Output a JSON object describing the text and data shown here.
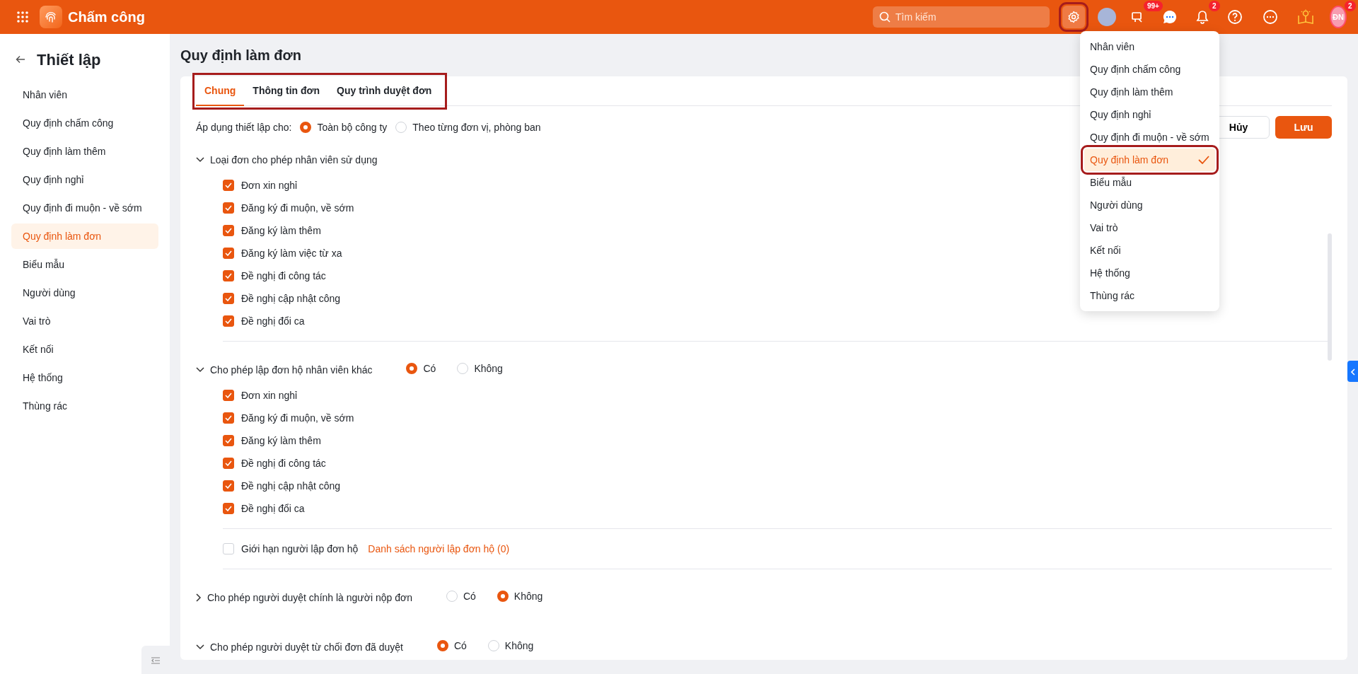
{
  "topbar": {
    "app_title": "Chấm công",
    "search": {
      "placeholder": "Tìm kiếm"
    },
    "settings_highlighted": true,
    "tasks_badge": "99+",
    "notifications_badge": "2",
    "user_initials": "ĐN",
    "user_badge": "2"
  },
  "sidebar": {
    "title": "Thiết lập",
    "items": [
      {
        "label": "Nhân viên",
        "selected": false
      },
      {
        "label": "Quy định chấm công",
        "selected": false
      },
      {
        "label": "Quy định làm thêm",
        "selected": false
      },
      {
        "label": "Quy định nghỉ",
        "selected": false
      },
      {
        "label": "Quy định đi muộn - về sớm",
        "selected": false
      },
      {
        "label": "Quy định làm đơn",
        "selected": true
      },
      {
        "label": "Biểu mẫu",
        "selected": false
      },
      {
        "label": "Người dùng",
        "selected": false
      },
      {
        "label": "Vai trò",
        "selected": false
      },
      {
        "label": "Kết nối",
        "selected": false
      },
      {
        "label": "Hệ thống",
        "selected": false
      },
      {
        "label": "Thùng rác",
        "selected": false
      }
    ]
  },
  "page_title": "Quy định làm đơn",
  "tabs_highlighted": true,
  "tabs": [
    {
      "label": "Chung",
      "selected": true
    },
    {
      "label": "Thông tin đơn",
      "selected": false
    },
    {
      "label": "Quy trình duyệt đơn",
      "selected": false
    }
  ],
  "apply_to": {
    "label": "Áp dụng thiết lập cho:",
    "options": [
      {
        "label": "Toàn bộ công ty",
        "selected": true
      },
      {
        "label": "Theo từng đơn vị, phòng ban",
        "selected": false
      }
    ]
  },
  "buttons": [
    {
      "label": "Hủy",
      "kind": "secondary"
    },
    {
      "label": "Lưu",
      "kind": "primary"
    }
  ],
  "sections": [
    {
      "title": "Loại đơn cho phép nhân viên sử dụng",
      "expanded": true,
      "items": [
        {
          "label": "Đơn xin nghỉ",
          "checked": true
        },
        {
          "label": "Đăng ký đi muộn, về sớm",
          "checked": true
        },
        {
          "label": "Đăng ký làm thêm",
          "checked": true
        },
        {
          "label": "Đăng ký làm việc từ xa",
          "checked": true
        },
        {
          "label": "Đề nghị đi công tác",
          "checked": true
        },
        {
          "label": "Đề nghị cập nhật công",
          "checked": true
        },
        {
          "label": "Đề nghị đổi ca",
          "checked": true
        }
      ]
    },
    {
      "title": "Cho phép lập đơn hộ nhân viên khác",
      "expanded": true,
      "options": [
        {
          "label": "Có",
          "selected": true
        },
        {
          "label": "Không",
          "selected": false
        }
      ],
      "items": [
        {
          "label": "Đơn xin nghỉ",
          "checked": true
        },
        {
          "label": "Đăng ký đi muộn, về sớm",
          "checked": true
        },
        {
          "label": "Đăng ký làm thêm",
          "checked": true
        },
        {
          "label": "Đề nghị đi công tác",
          "checked": true
        },
        {
          "label": "Đề nghị cập nhật công",
          "checked": true
        },
        {
          "label": "Đề nghị đổi ca",
          "checked": true
        }
      ],
      "limit": {
        "label": "Giới hạn người lập đơn hộ",
        "checked": false,
        "link": "Danh sách người lập đơn hộ (0)"
      }
    },
    {
      "title": "Cho phép người duyệt chính là người nộp đơn",
      "expanded": false,
      "options": [
        {
          "label": "Có",
          "selected": false
        },
        {
          "label": "Không",
          "selected": true
        }
      ]
    },
    {
      "title": "Cho phép người duyệt từ chối đơn đã duyệt",
      "expanded": true,
      "options": [
        {
          "label": "Có",
          "selected": true
        },
        {
          "label": "Không",
          "selected": false
        }
      ]
    }
  ],
  "settings_menu": {
    "items": [
      {
        "label": "Nhân viên",
        "selected": false,
        "highlighted": false
      },
      {
        "label": "Quy định chấm công",
        "selected": false,
        "highlighted": false
      },
      {
        "label": "Quy định làm thêm",
        "selected": false,
        "highlighted": false
      },
      {
        "label": "Quy định nghỉ",
        "selected": false,
        "highlighted": false
      },
      {
        "label": "Quy định đi muộn - về sớm",
        "selected": false,
        "highlighted": false
      },
      {
        "label": "Quy định làm đơn",
        "selected": true,
        "highlighted": true
      },
      {
        "label": "Biểu mẫu",
        "selected": false,
        "highlighted": false
      },
      {
        "label": "Người dùng",
        "selected": false,
        "highlighted": false
      },
      {
        "label": "Vai trò",
        "selected": false,
        "highlighted": false
      },
      {
        "label": "Kết nối",
        "selected": false,
        "highlighted": false
      },
      {
        "label": "Hệ thống",
        "selected": false,
        "highlighted": false
      },
      {
        "label": "Thùng rác",
        "selected": false,
        "highlighted": false
      }
    ]
  }
}
